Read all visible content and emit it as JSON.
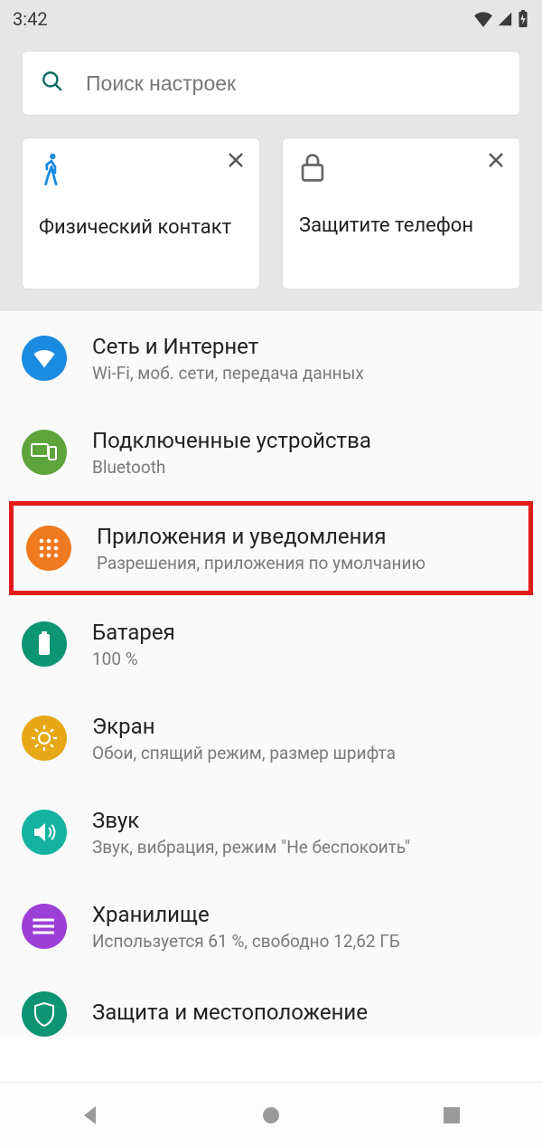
{
  "statusbar": {
    "time": "3:42"
  },
  "search": {
    "placeholder": "Поиск настроек"
  },
  "cards": [
    {
      "title": "Физический контакт",
      "icon": "walk"
    },
    {
      "title": "Защитите телефон",
      "icon": "lock"
    }
  ],
  "items": [
    {
      "title": "Сеть и Интернет",
      "sub": "Wi-Fi, моб. сети, передача данных",
      "icon": "wifi",
      "color": "#1a8be0"
    },
    {
      "title": "Подключенные устройства",
      "sub": "Bluetooth",
      "icon": "devices",
      "color": "#5da43b"
    },
    {
      "title": "Приложения и уведомления",
      "sub": "Разрешения, приложения по умолчанию",
      "icon": "apps",
      "color": "#ef7a1f",
      "highlight": true
    },
    {
      "title": "Батарея",
      "sub": "100 %",
      "icon": "battery",
      "color": "#0d9474"
    },
    {
      "title": "Экран",
      "sub": "Обои, спящий режим, размер шрифта",
      "icon": "display",
      "color": "#e7a817"
    },
    {
      "title": "Звук",
      "sub": "Звук, вибрация, режим \"Не беспокоить\"",
      "icon": "sound",
      "color": "#14b2a1"
    },
    {
      "title": "Хранилище",
      "sub": "Используется 61 %, свободно 12,62 ГБ",
      "icon": "storage",
      "color": "#9b3fd6"
    },
    {
      "title": "Защита и местоположение",
      "sub": "",
      "icon": "security",
      "color": "#0d9474"
    }
  ]
}
